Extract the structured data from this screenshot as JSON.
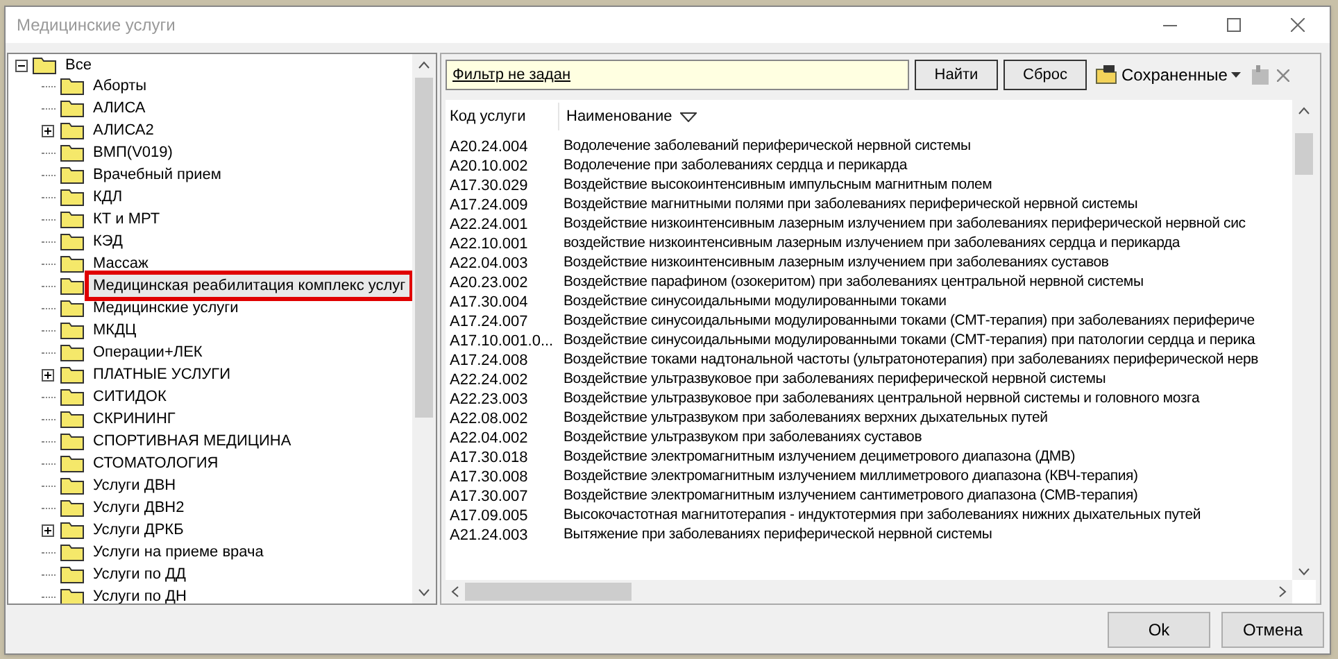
{
  "window": {
    "title": "Медицинские услуги"
  },
  "tree": {
    "label": "Все",
    "expanded": true,
    "children": [
      {
        "label": "Аборты",
        "expandable": false,
        "selected": false
      },
      {
        "label": "АЛИСА",
        "expandable": false,
        "selected": false
      },
      {
        "label": "АЛИСА2",
        "expandable": true,
        "selected": false
      },
      {
        "label": "ВМП(V019)",
        "expandable": false,
        "selected": false
      },
      {
        "label": "Врачебный прием",
        "expandable": false,
        "selected": false
      },
      {
        "label": "КДЛ",
        "expandable": false,
        "selected": false
      },
      {
        "label": "КТ и МРТ",
        "expandable": false,
        "selected": false
      },
      {
        "label": "КЭД",
        "expandable": false,
        "selected": false
      },
      {
        "label": "Массаж",
        "expandable": false,
        "selected": false
      },
      {
        "label": "Медицинская реабилитация комплекс услуг",
        "expandable": false,
        "selected": true
      },
      {
        "label": "Медицинские услуги",
        "expandable": false,
        "selected": false
      },
      {
        "label": "МКДЦ",
        "expandable": false,
        "selected": false
      },
      {
        "label": "Операции+ЛЕК",
        "expandable": false,
        "selected": false
      },
      {
        "label": "ПЛАТНЫЕ УСЛУГИ",
        "expandable": true,
        "selected": false
      },
      {
        "label": "СИТИДОК",
        "expandable": false,
        "selected": false
      },
      {
        "label": "СКРИНИНГ",
        "expandable": false,
        "selected": false
      },
      {
        "label": "СПОРТИВНАЯ МЕДИЦИНА",
        "expandable": false,
        "selected": false
      },
      {
        "label": "СТОМАТОЛОГИЯ",
        "expandable": false,
        "selected": false
      },
      {
        "label": "Услуги ДВН",
        "expandable": false,
        "selected": false
      },
      {
        "label": "Услуги ДВН2",
        "expandable": false,
        "selected": false
      },
      {
        "label": "Услуги ДРКБ",
        "expandable": true,
        "selected": false
      },
      {
        "label": "Услуги на приеме врача",
        "expandable": false,
        "selected": false
      },
      {
        "label": "Услуги по ДД",
        "expandable": false,
        "selected": false
      },
      {
        "label": "Услуги по ДН",
        "expandable": false,
        "selected": false
      }
    ]
  },
  "filter": {
    "value": "Фильтр не задан",
    "buttons": [
      "Найти",
      "Сброс"
    ],
    "saved": "Сохраненные"
  },
  "table": {
    "columns": [
      "Код услуги",
      "Наименование"
    ],
    "rows": [
      [
        "A20.24.004",
        "Водолечение заболеваний периферической нервной системы"
      ],
      [
        "A20.10.002",
        "Водолечение при заболеваниях сердца и перикарда"
      ],
      [
        "A17.30.029",
        "Воздействие высокоинтенсивным импульсным магнитным полем"
      ],
      [
        "A17.24.009",
        "Воздействие магнитными полями при заболеваниях периферической нервной системы"
      ],
      [
        "A22.24.001",
        "Воздействие низкоинтенсивным лазерным излучением при заболеваниях периферической нервной сис"
      ],
      [
        "A22.10.001",
        "воздействие низкоинтенсивным лазерным излучением при заболеваниях сердца и перикарда"
      ],
      [
        "A22.04.003",
        "Воздействие низкоинтенсивным лазерным излучением при заболеваниях суставов"
      ],
      [
        "A20.23.002",
        "Воздействие парафином (озокеритом) при заболеваниях центральной нервной системы"
      ],
      [
        "A17.30.004",
        "Воздействие синусоидальными модулированными токами"
      ],
      [
        "A17.24.007",
        "Воздействие синусоидальными модулированными токами (СМТ-терапия) при заболеваниях перифериче"
      ],
      [
        "A17.10.001.0...",
        "Воздействие синусоидальными модулированными токами (СМТ-терапия) при патологии сердца и перика"
      ],
      [
        "A17.24.008",
        "Воздействие токами надтональной частоты (ультратонотерапия) при заболеваниях периферической нерв"
      ],
      [
        "A22.24.002",
        "Воздействие ультразвуковое при заболеваниях периферической нервной системы"
      ],
      [
        "A22.23.003",
        "Воздействие ультразвуковое при заболеваниях центральной нервной системы и головного мозга"
      ],
      [
        "A22.08.002",
        "Воздействие ультразвуком при заболеваниях верхних дыхательных путей"
      ],
      [
        "A22.04.002",
        "Воздействие ультразвуком при заболеваниях суставов"
      ],
      [
        "A17.30.018",
        "Воздействие электромагнитным излучением дециметрового диапазона (ДМВ)"
      ],
      [
        "A17.30.008",
        "Воздействие электромагнитным излучением миллиметрового диапазона (КВЧ-терапия)"
      ],
      [
        "A17.30.007",
        "Воздействие электромагнитным излучением сантиметрового диапазона (СМВ-терапия)"
      ],
      [
        "A17.09.005",
        "Высокочастотная магнитотерапия - индуктотермия при заболеваниях нижних дыхательных путей"
      ],
      [
        "A21.24.003",
        "Вытяжение при заболеваниях периферической нервной системы"
      ]
    ]
  },
  "buttons": [
    "Ok",
    "Отмена"
  ]
}
